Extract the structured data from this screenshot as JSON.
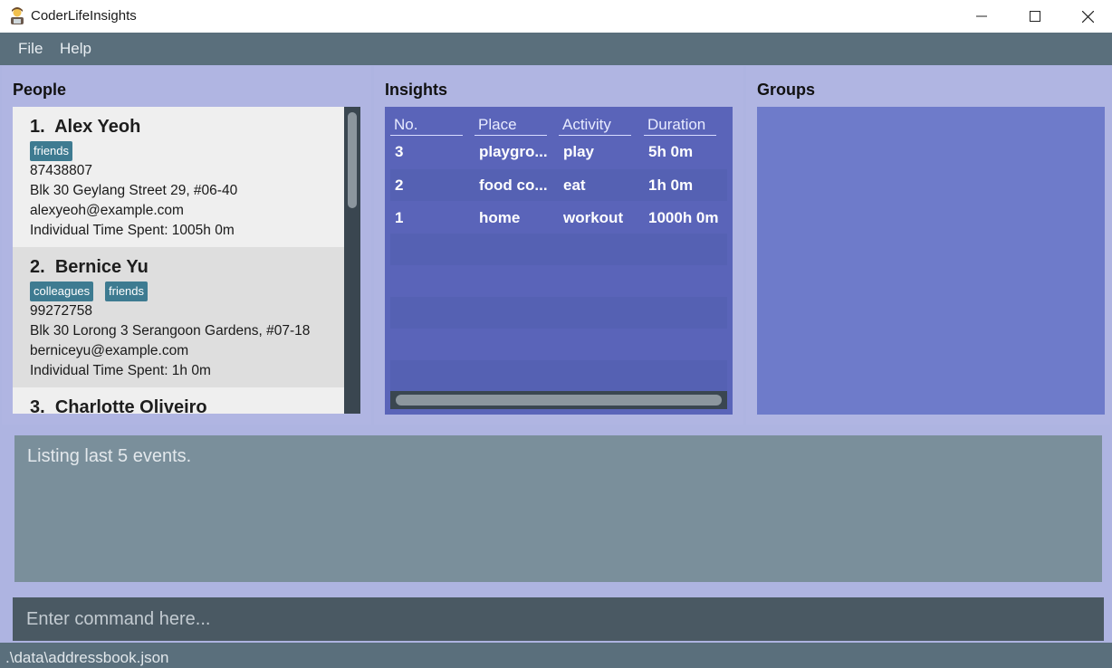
{
  "window": {
    "title": "CoderLifeInsights",
    "icon": "person-coder-icon"
  },
  "menu": {
    "file": "File",
    "help": "Help"
  },
  "panels": {
    "people": "People",
    "insights": "Insights",
    "groups": "Groups"
  },
  "people": [
    {
      "index": "1.",
      "name": "Alex Yeoh",
      "tags": [
        "friends"
      ],
      "phone": "87438807",
      "address": "Blk 30 Geylang Street 29, #06-40",
      "email": "alexyeoh@example.com",
      "time": "Individual Time Spent: 1005h 0m"
    },
    {
      "index": "2.",
      "name": "Bernice Yu",
      "tags": [
        "colleagues",
        "friends"
      ],
      "phone": "99272758",
      "address": "Blk 30 Lorong 3 Serangoon Gardens, #07-18",
      "email": "berniceyu@example.com",
      "time": "Individual Time Spent: 1h 0m"
    },
    {
      "index": "3.",
      "name": "Charlotte Oliveiro"
    }
  ],
  "insights": {
    "columns": [
      "No.",
      "Place",
      "Activity",
      "Duration"
    ],
    "rows": [
      [
        "3",
        "playgro...",
        "play",
        "5h 0m"
      ],
      [
        "2",
        "food co...",
        "eat",
        "1h 0m"
      ],
      [
        "1",
        "home",
        "workout",
        "1000h 0m"
      ]
    ]
  },
  "result": "Listing last 5 events.",
  "command": {
    "placeholder": "Enter command here..."
  },
  "status": ".\\data\\addressbook.json",
  "colors": {
    "tag": "#3e7b91",
    "menubar": "#5a6f7c",
    "insights_bg": "#5a64b9",
    "groups_bg": "#6e7bca",
    "panel_bg": "#b0b5e2"
  }
}
